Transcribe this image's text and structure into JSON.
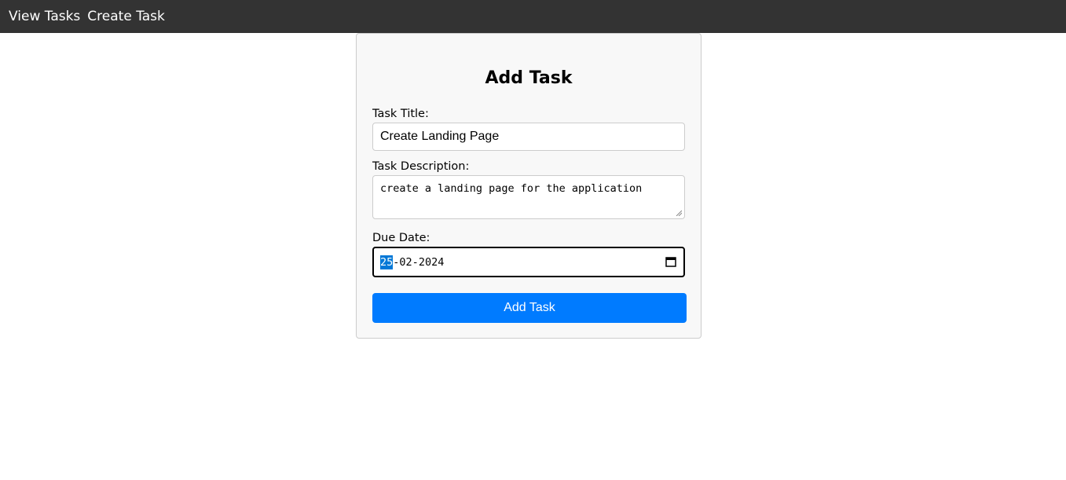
{
  "nav": {
    "items": [
      {
        "label": "View Tasks"
      },
      {
        "label": "Create Task"
      }
    ],
    "background": "#333333"
  },
  "form": {
    "title": "Add Task",
    "title_field": {
      "label": "Task Title:",
      "value": "Create Landing Page"
    },
    "description_field": {
      "label": "Task Description:",
      "value": "create a landing page for the application"
    },
    "due_date_field": {
      "label": "Due Date:",
      "day": "25",
      "month": "02",
      "year": "2024",
      "separator": "-",
      "icon": "calendar-icon"
    },
    "submit_label": "Add Task",
    "accent_color": "#007bff"
  }
}
